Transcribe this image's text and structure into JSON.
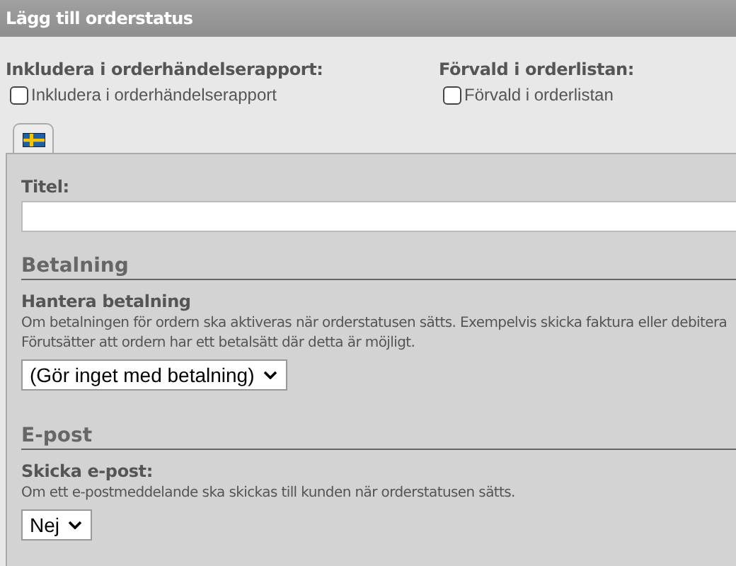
{
  "header": {
    "title": "Lägg till orderstatus"
  },
  "options": [
    {
      "label": "Inkludera i orderhändelserapport:",
      "checkbox_label": "Inkludera i orderhändelserapport",
      "checked": false
    },
    {
      "label": "Förvald i orderlistan:",
      "checkbox_label": "Förvald i orderlistan",
      "checked": false
    }
  ],
  "tabs": [
    {
      "selected": true
    }
  ],
  "title_field": {
    "label": "Titel:"
  },
  "sections": [
    {
      "heading": "Betalning",
      "field_label": "Hantera betalning",
      "description": "Om betalningen för ordern ska aktiveras när orderstatusen sätts. Exempelvis skicka faktura eller debitera\nFörutsätter att ordern har ett betalsätt där detta är möjligt.",
      "select_value": "(Gör inget med betalning)"
    },
    {
      "heading": "E-post",
      "field_label": "Skicka e-post:",
      "description": "Om ett e-postmeddelande ska skickas till kunden när orderstatusen sätts.",
      "select_value": "Nej"
    }
  ]
}
